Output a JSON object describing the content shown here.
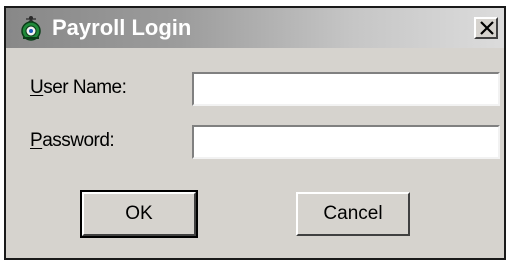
{
  "window": {
    "title": "Payroll Login",
    "app_icon": "payroll-app-icon",
    "close_icon": "close-icon",
    "close_glyph": "X"
  },
  "form": {
    "user_name": {
      "label_mnemonic": "U",
      "label_rest": "ser Name:",
      "value": "",
      "placeholder": ""
    },
    "password": {
      "label_mnemonic": "P",
      "label_rest": "assword:",
      "value": "",
      "placeholder": ""
    }
  },
  "buttons": {
    "ok_label": "OK",
    "cancel_label": "Cancel"
  },
  "colors": {
    "face": "#d6d3ce",
    "title_gradient_start": "#888888",
    "title_gradient_end": "#dcdcdc",
    "title_text": "#ffffff"
  }
}
